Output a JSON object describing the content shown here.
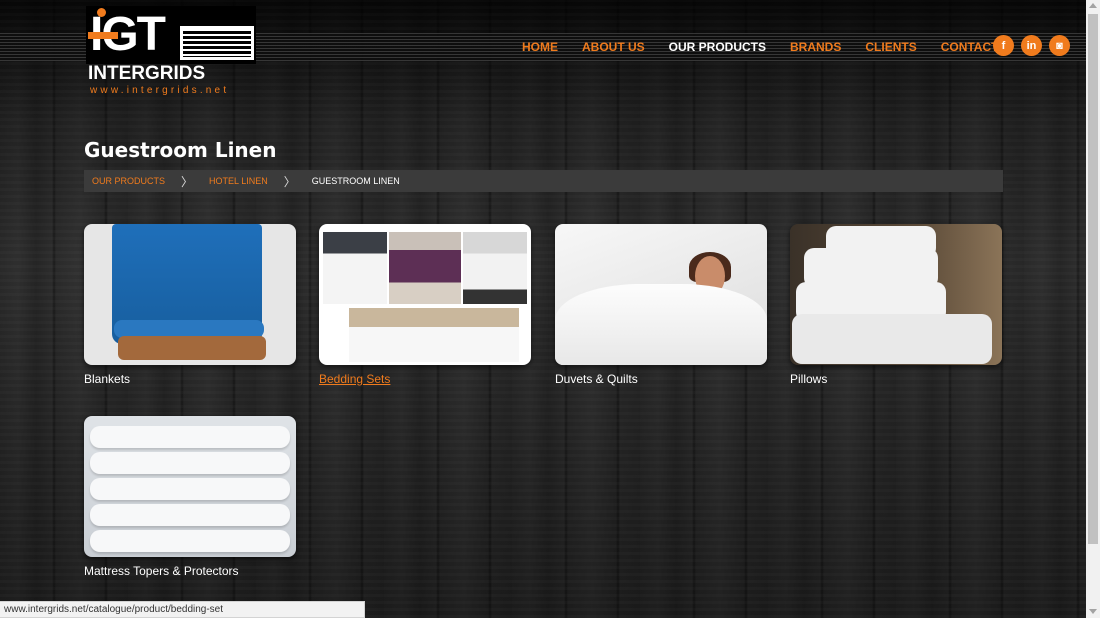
{
  "header": {
    "logo": {
      "letters": "IGT",
      "word_start": "INTERGRIDS",
      "url": "www.intergrids.net"
    },
    "nav": [
      {
        "label": "HOME",
        "active": false
      },
      {
        "label": "ABOUT US",
        "active": false
      },
      {
        "label": "OUR PRODUCTS",
        "active": true
      },
      {
        "label": "BRANDS",
        "active": false
      },
      {
        "label": "CLIENTS",
        "active": false
      },
      {
        "label": "CONTACT",
        "active": false
      }
    ],
    "social": [
      {
        "icon": "facebook-icon",
        "glyph": "f"
      },
      {
        "icon": "linkedin-icon",
        "glyph": "in"
      },
      {
        "icon": "instagram-icon",
        "glyph": "◙"
      }
    ]
  },
  "main": {
    "title": "Guestroom Linen",
    "breadcrumb": [
      "OUR PRODUCTS",
      "HOTEL LINEN",
      "GUESTROOM LINEN"
    ],
    "products": [
      {
        "label": "Blankets"
      },
      {
        "label": "Bedding Sets"
      },
      {
        "label": "Duvets & Quilts"
      },
      {
        "label": "Pillows"
      },
      {
        "label": "Mattress Topers & Protectors"
      }
    ]
  },
  "status_bar": {
    "url": "www.intergrids.net/catalogue/product/bedding-set"
  },
  "colors": {
    "accent": "#f07b1d",
    "text": "#ffffff",
    "breadcrumb_bg": "#3b3b3b"
  }
}
